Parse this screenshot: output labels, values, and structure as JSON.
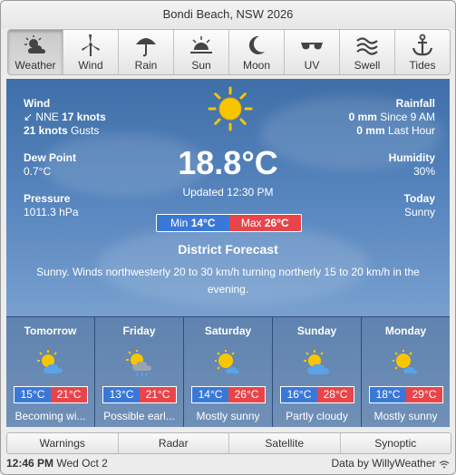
{
  "title": "Bondi Beach, NSW 2026",
  "tabs": [
    {
      "label": "Weather",
      "icon": "weather-icon"
    },
    {
      "label": "Wind",
      "icon": "wind-turbine-icon"
    },
    {
      "label": "Rain",
      "icon": "umbrella-icon"
    },
    {
      "label": "Sun",
      "icon": "sun-icon"
    },
    {
      "label": "Moon",
      "icon": "moon-icon"
    },
    {
      "label": "UV",
      "icon": "sunglasses-icon"
    },
    {
      "label": "Swell",
      "icon": "waves-icon"
    },
    {
      "label": "Tides",
      "icon": "anchor-icon"
    }
  ],
  "current": {
    "wind_label": "Wind",
    "wind_dir": "NNE",
    "wind_speed": "17 knots",
    "gusts_speed": "21 knots",
    "gusts_label": "Gusts",
    "dew_label": "Dew Point",
    "dew_value": "0.7°C",
    "pressure_label": "Pressure",
    "pressure_value": "1011.3 hPa",
    "rain_label": "Rainfall",
    "rain_since_value": "0 mm",
    "rain_since_text": "Since 9 AM",
    "rain_last_value": "0 mm",
    "rain_last_text": "Last Hour",
    "humidity_label": "Humidity",
    "humidity_value": "30%",
    "today_label": "Today",
    "today_value": "Sunny",
    "temperature": "18.8°C",
    "updated": "Updated 12:30 PM",
    "min_label": "Min",
    "min_value": "14°C",
    "max_label": "Max",
    "max_value": "26°C"
  },
  "district": {
    "title": "District Forecast",
    "text": "Sunny. Winds northwesterly 20 to 30 km/h turning northerly 15 to 20 km/h in the evening."
  },
  "forecast": [
    {
      "day": "Tomorrow",
      "min": "15°C",
      "max": "21°C",
      "summary": "Becoming wi...",
      "icon": "partly-cloudy-icon"
    },
    {
      "day": "Friday",
      "min": "13°C",
      "max": "21°C",
      "summary": "Possible earl...",
      "icon": "showers-icon"
    },
    {
      "day": "Saturday",
      "min": "14°C",
      "max": "26°C",
      "summary": "Mostly sunny",
      "icon": "mostly-sunny-icon"
    },
    {
      "day": "Sunday",
      "min": "16°C",
      "max": "28°C",
      "summary": "Partly cloudy",
      "icon": "partly-cloudy-icon"
    },
    {
      "day": "Monday",
      "min": "18°C",
      "max": "29°C",
      "summary": "Mostly sunny",
      "icon": "mostly-sunny-icon"
    }
  ],
  "bottom_tabs": [
    "Warnings",
    "Radar",
    "Satellite",
    "Synoptic"
  ],
  "status": {
    "time": "12:46 PM",
    "date": "Wed Oct 2",
    "credit": "Data by WillyWeather"
  },
  "colors": {
    "min": "#3a78d8",
    "max": "#e8454b",
    "sun": "#f7c600"
  }
}
